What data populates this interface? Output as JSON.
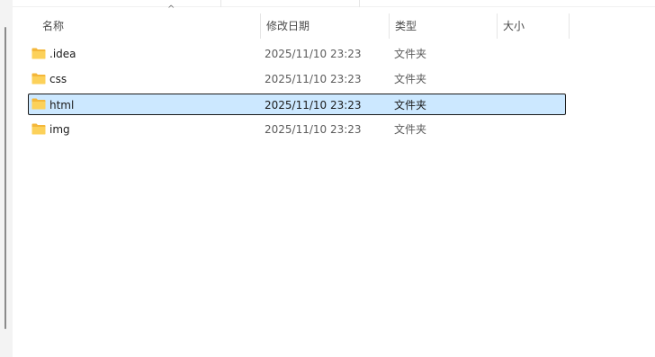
{
  "columns": {
    "name": "名称",
    "date": "修改日期",
    "type": "类型",
    "size": "大小"
  },
  "sort_indicator": "^",
  "colors": {
    "selection_bg": "#cce8ff",
    "folder_yellow": "#f8c94c"
  },
  "files": [
    {
      "name": ".idea",
      "date": "2025/11/10 23:23",
      "type": "文件夹",
      "icon": "folder-icon",
      "selected": false
    },
    {
      "name": "css",
      "date": "2025/11/10 23:23",
      "type": "文件夹",
      "icon": "folder-icon",
      "selected": false
    },
    {
      "name": "html",
      "date": "2025/11/10 23:23",
      "type": "文件夹",
      "icon": "folder-icon",
      "selected": true
    },
    {
      "name": "img",
      "date": "2025/11/10 23:23",
      "type": "文件夹",
      "icon": "folder-icon",
      "selected": false
    }
  ]
}
